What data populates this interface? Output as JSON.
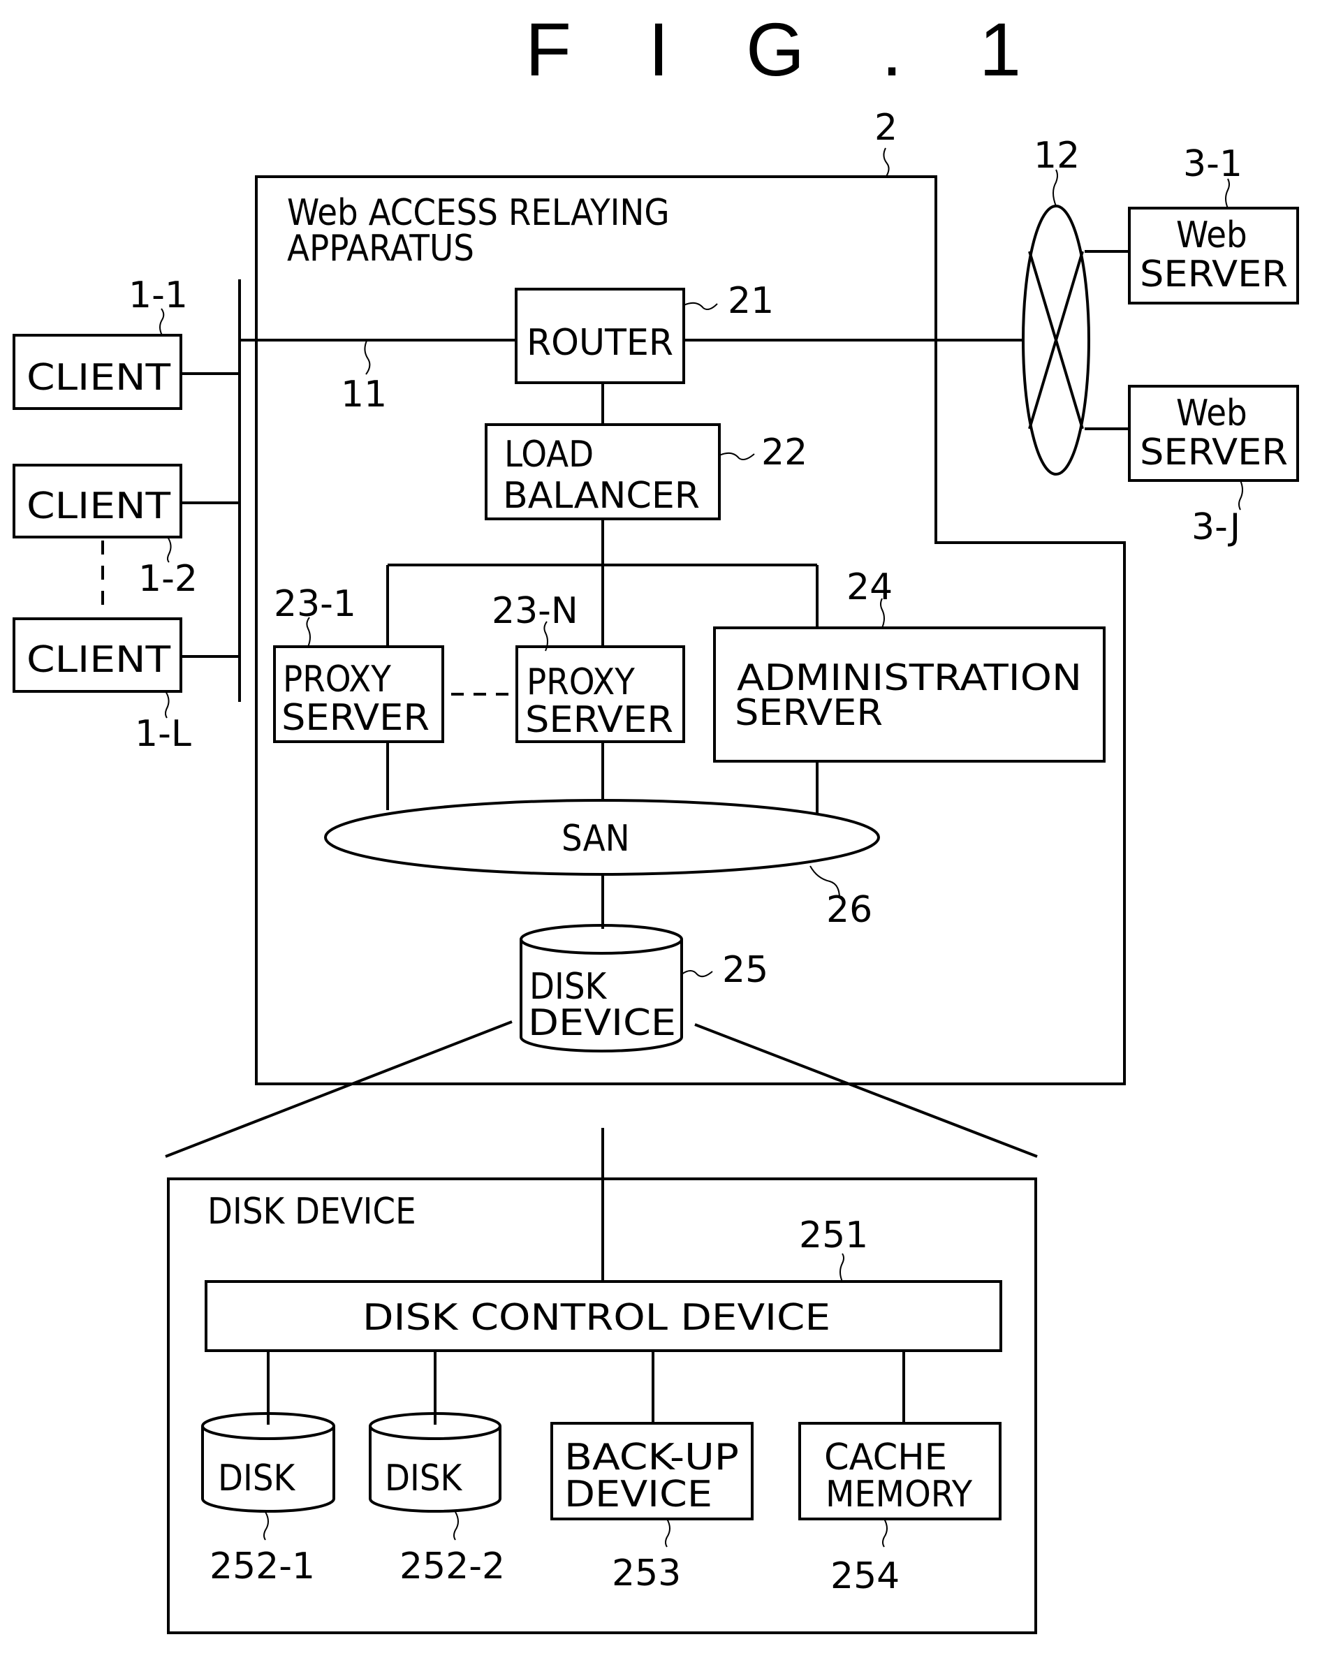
{
  "figure": {
    "title": "F I G . 1"
  },
  "apparatus": {
    "ref": "2",
    "title_line1": "Web  ACCESS  RELAYING",
    "title_line2": "APPARATUS"
  },
  "clients": [
    {
      "label": "CLIENT",
      "ref": "1-1"
    },
    {
      "label": "CLIENT",
      "ref": "1-2"
    },
    {
      "label": "CLIENT",
      "ref": "1-L"
    }
  ],
  "network_lan": {
    "ref": "11"
  },
  "network_wan": {
    "ref": "12"
  },
  "router": {
    "label": "ROUTER",
    "ref": "21"
  },
  "load_balancer": {
    "line1": "LOAD",
    "line2": "BALANCER",
    "ref": "22"
  },
  "proxy_servers": [
    {
      "line1": "PROXY",
      "line2": "SERVER",
      "ref": "23-1"
    },
    {
      "line1": "PROXY",
      "line2": "SERVER",
      "ref": "23-N"
    }
  ],
  "admin_server": {
    "line1": "ADMINISTRATION",
    "line2": "SERVER",
    "ref": "24"
  },
  "san": {
    "label": "SAN",
    "ref": "26"
  },
  "disk_device": {
    "line1": "DISK",
    "line2": "DEVICE",
    "ref": "25"
  },
  "web_servers": [
    {
      "line1": "Web",
      "line2": "SERVER",
      "ref": "3-1"
    },
    {
      "line1": "Web",
      "line2": "SERVER",
      "ref": "3-J"
    }
  ],
  "disk_device_detail": {
    "title": "DISK  DEVICE",
    "control": {
      "label": "DISK  CONTROL  DEVICE",
      "ref": "251"
    },
    "disks": [
      {
        "label": "DISK",
        "ref": "252-1"
      },
      {
        "label": "DISK",
        "ref": "252-2"
      }
    ],
    "backup": {
      "line1": "BACK-UP",
      "line2": "DEVICE",
      "ref": "253"
    },
    "cache": {
      "line1": "CACHE",
      "line2": "MEMORY",
      "ref": "254"
    }
  }
}
